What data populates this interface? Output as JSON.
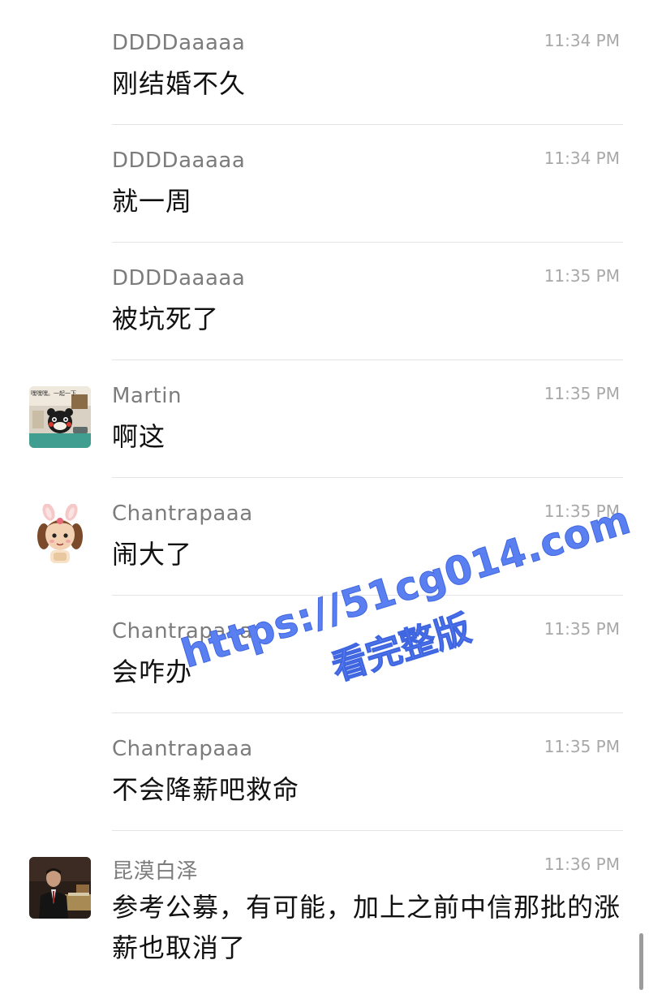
{
  "messages": [
    {
      "sender": "DDDDaaaaa",
      "time": "11:34 PM",
      "text": "刚结婚不久"
    },
    {
      "sender": "DDDDaaaaa",
      "time": "11:34 PM",
      "text": "就一周"
    },
    {
      "sender": "DDDDaaaaa",
      "time": "11:35 PM",
      "text": "被坑死了"
    },
    {
      "sender": "Martin",
      "time": "11:35 PM",
      "text": "啊这",
      "avatar_text": "嘿嘿嘿。一起一下"
    },
    {
      "sender": "Chantrapaaa",
      "time": "11:35 PM",
      "text": "闹大了"
    },
    {
      "sender": "Chantrapaaa",
      "time": "11:35 PM",
      "text": "会咋办"
    },
    {
      "sender": "Chantrapaaa",
      "time": "11:35 PM",
      "text": "不会降薪吧救命"
    },
    {
      "sender": "昆漠白泽",
      "time": "11:36 PM",
      "text": "参考公募，有可能，加上之前中信那批的涨薪也取消了"
    }
  ],
  "watermark": {
    "line1": "https://51cg014.com",
    "line2": "看完整版"
  },
  "colors": {
    "sender": "#7c7c7c",
    "time": "#a8a8a8",
    "text": "#111111",
    "divider": "#e4e4e4",
    "watermark": "#5a7ff0"
  }
}
